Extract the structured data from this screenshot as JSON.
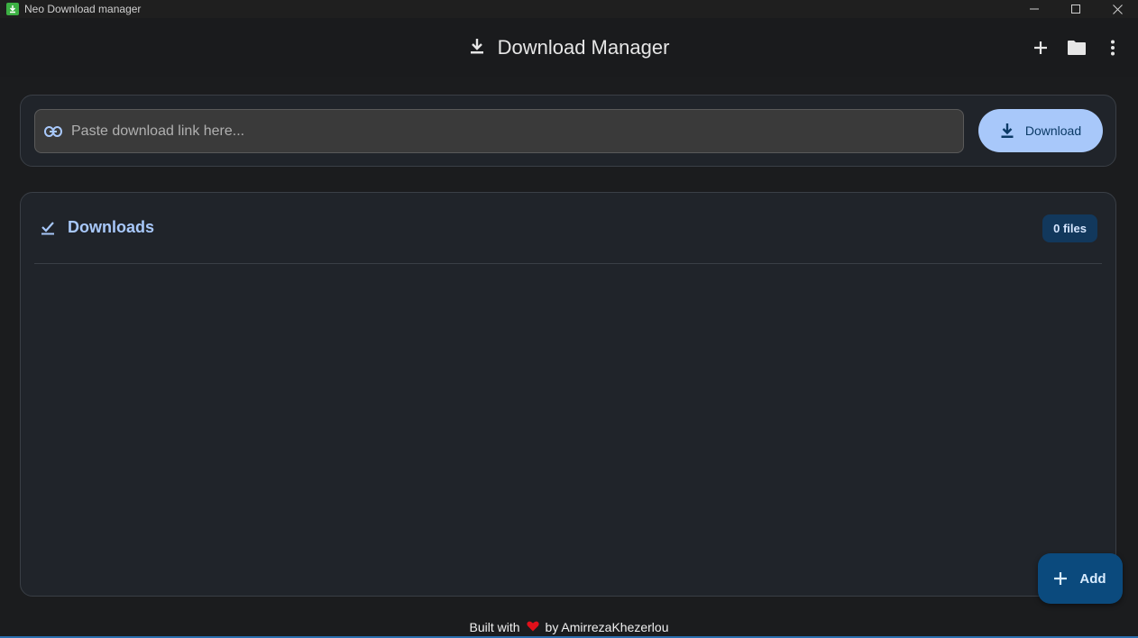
{
  "window": {
    "title": "Neo Download manager",
    "controls": {
      "minimize": "minimize-icon",
      "maximize": "maximize-icon",
      "close": "close-icon"
    }
  },
  "appbar": {
    "title": "Download Manager",
    "title_icon": "download-icon",
    "actions": [
      {
        "name": "add",
        "icon": "plus-icon"
      },
      {
        "name": "open-folder",
        "icon": "folder-icon"
      },
      {
        "name": "more",
        "icon": "more-vertical-icon"
      }
    ]
  },
  "url_bar": {
    "placeholder": "Paste download link here...",
    "value": "",
    "icon": "link-icon",
    "download_label": "Download"
  },
  "downloads": {
    "title": "Downloads",
    "icon": "check-icon",
    "count_label": "0 files",
    "items": []
  },
  "fab": {
    "label": "Add",
    "icon": "plus-icon"
  },
  "footer": {
    "prefix": "Built with",
    "suffix": "by AmirrezaKhezerlou",
    "icon": "heart-icon"
  },
  "colors": {
    "accent": "#a8c8fa",
    "fab": "#0b4a7d",
    "badge": "#12385c",
    "heart": "#e0101a",
    "app_icon": "#3cb043"
  }
}
